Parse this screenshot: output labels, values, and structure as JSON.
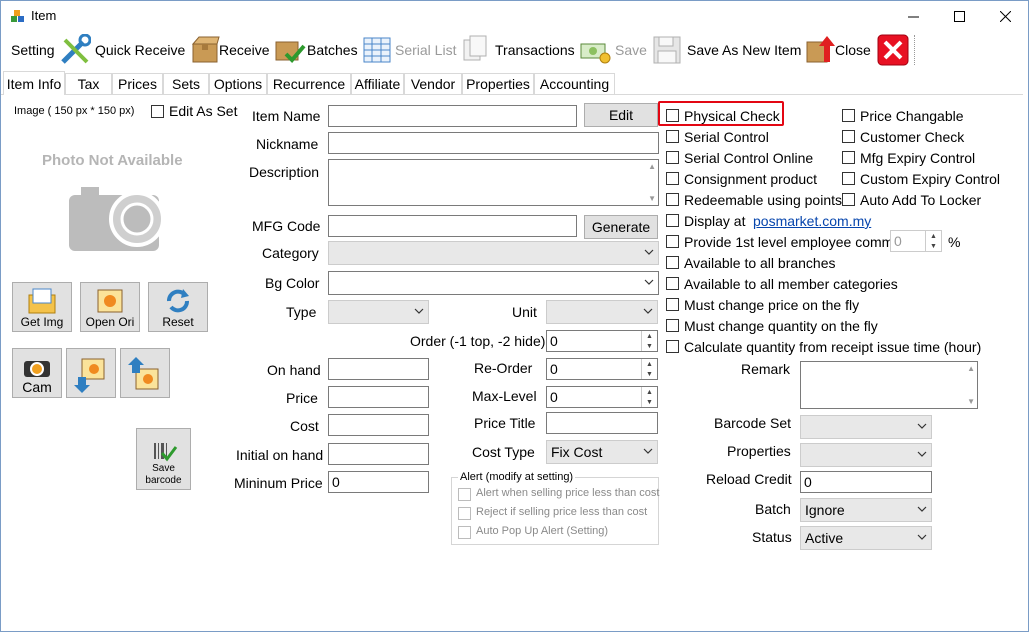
{
  "window": {
    "title": "Item",
    "min_label": "—",
    "max_label": "☐",
    "close_label": "✕"
  },
  "toolbar": {
    "setting": "Setting",
    "quick_receive": "Quick Receive",
    "receive": "Receive",
    "batches": "Batches",
    "serial_list": "Serial List",
    "transactions": "Transactions",
    "save": "Save",
    "save_as_new_item": "Save As New Item",
    "close": "Close"
  },
  "tabs": [
    "Item Info",
    "Tax",
    "Prices",
    "Sets",
    "Options",
    "Recurrence",
    "Affiliate",
    "Vendor",
    "Properties",
    "Accounting"
  ],
  "image": {
    "size_label": "Image ( 150 px * 150 px)",
    "edit_as_set": "Edit As Set",
    "photo_not_available": "Photo Not Available",
    "get_img": "Get Img",
    "open_ori": "Open Ori",
    "reset": "Reset",
    "cam": "Cam",
    "save_barcode_line1": "Save",
    "save_barcode_line2": "barcode"
  },
  "form": {
    "item_name": "Item Name",
    "edit_button": "Edit",
    "nickname": "Nickname",
    "description": "Description",
    "mfg_code": "MFG Code",
    "generate_button": "Generate",
    "category": "Category",
    "bg_color": "Bg Color",
    "type": "Type",
    "unit": "Unit",
    "order_label": "Order (-1 top, -2 hide)",
    "order_value": "0",
    "on_hand": "On hand",
    "re_order": "Re-Order",
    "re_order_value": "0",
    "price": "Price",
    "max_level": "Max-Level",
    "max_level_value": "0",
    "cost": "Cost",
    "price_title": "Price Title",
    "initial_on_hand": "Initial on hand",
    "cost_type": "Cost Type",
    "cost_type_value": "Fix Cost",
    "minimum_price": "Mininum Price",
    "minimum_price_value": "0"
  },
  "alert": {
    "legend": "Alert (modify at setting)",
    "opt1": "Alert when selling price less than cost",
    "opt2": "Reject if selling price less than cost",
    "opt3": "Auto Pop Up Alert (Setting)"
  },
  "checks_left": {
    "physical_check": "Physical Check",
    "serial_control": "Serial Control",
    "serial_control_online": "Serial Control Online",
    "consignment_product": "Consignment product",
    "redeemable_using_points": "Redeemable using points",
    "display_at": "Display at",
    "display_at_link": "posmarket.com.my",
    "provide_commission": "Provide 1st level employee comm",
    "commission_value": "0",
    "percent": "%",
    "available_all_branches": "Available to all branches",
    "available_all_member": "Available to all member categories",
    "must_change_price": "Must change price on the fly",
    "must_change_quantity": "Must change quantity on the fly",
    "calculate_quantity": "Calculate quantity from receipt issue time (hour)"
  },
  "checks_right": {
    "price_changable": "Price Changable",
    "customer_check": "Customer Check",
    "mfg_expiry_control": "Mfg Expiry Control",
    "custom_expiry_control": "Custom Expiry Control",
    "auto_add_to_locker": "Auto Add To Locker"
  },
  "right_form": {
    "remark": "Remark",
    "barcode_set": "Barcode Set",
    "properties": "Properties",
    "reload_credit": "Reload Credit",
    "reload_credit_value": "0",
    "batch": "Batch",
    "batch_value": "Ignore",
    "status": "Status",
    "status_value": "Active"
  },
  "colors": {
    "highlight": "#e30613",
    "link": "#0645ad",
    "close_red": "#e81123"
  }
}
